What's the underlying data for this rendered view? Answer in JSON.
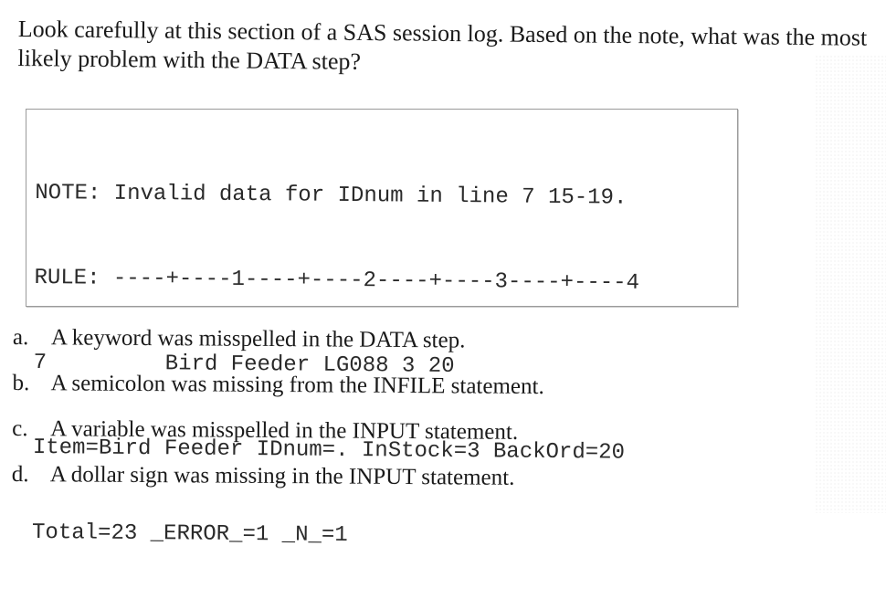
{
  "question": {
    "text": "Look carefully at this section of a SAS session log. Based on the note, what was the most likely problem with the DATA step?"
  },
  "log": {
    "lines": [
      "NOTE: Invalid data for IDnum in line 7 15-19.",
      "RULE: ----+----1----+----2----+----3----+----4",
      "7         Bird Feeder LG088 3 20",
      "Item=Bird Feeder IDnum=. InStock=3 BackOrd=20",
      "Total=23 _ERROR_=1 _N_=1"
    ]
  },
  "options": [
    {
      "letter": "a.",
      "text": "A keyword was misspelled in the DATA step."
    },
    {
      "letter": "b.",
      "text": "A semicolon was missing from the INFILE statement."
    },
    {
      "letter": "c.",
      "text": "A variable was misspelled in the INPUT statement."
    },
    {
      "letter": "d.",
      "text": "A dollar sign was missing in the INPUT statement."
    }
  ]
}
